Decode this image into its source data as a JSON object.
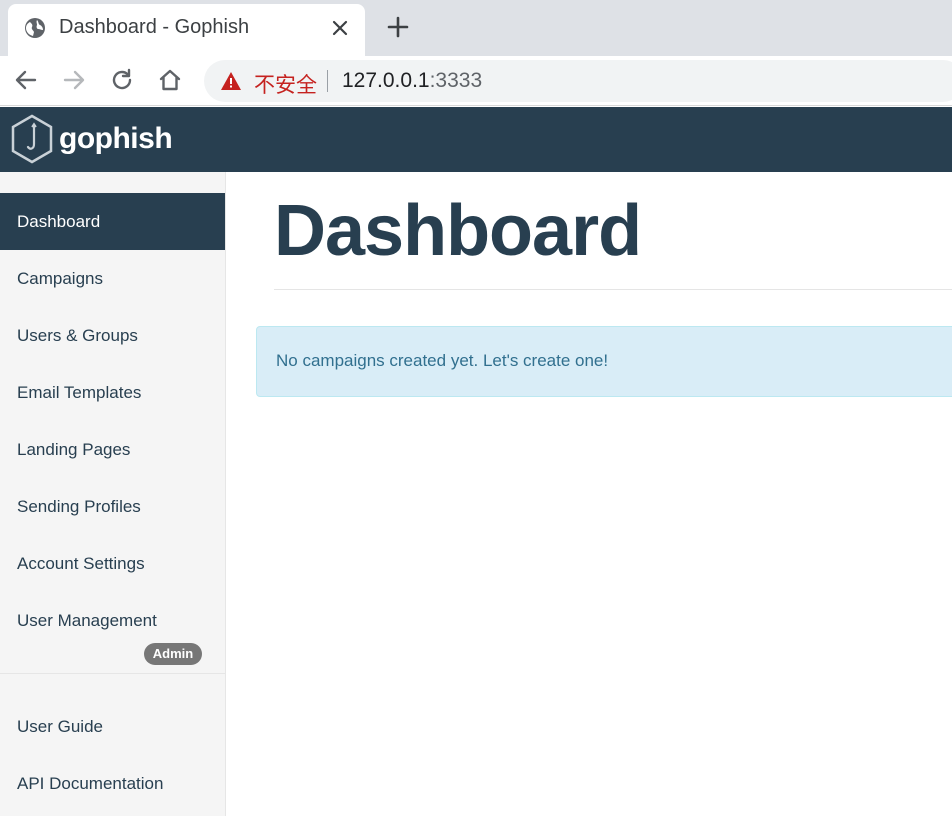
{
  "browser": {
    "tab_title": "Dashboard - Gophish",
    "security_label": "不安全",
    "url_host": "127.0.0.1",
    "url_port": ":3333",
    "icons": [
      "globe-icon",
      "close-icon",
      "plus-icon",
      "back-icon",
      "forward-icon",
      "reload-icon",
      "home-icon",
      "warning-icon"
    ]
  },
  "app": {
    "brand": "gophish",
    "brand_color": "#283f50"
  },
  "sidebar": {
    "items": [
      {
        "label": "Dashboard",
        "active": true
      },
      {
        "label": "Campaigns"
      },
      {
        "label": "Users & Groups"
      },
      {
        "label": "Email Templates"
      },
      {
        "label": "Landing Pages"
      },
      {
        "label": "Sending Profiles"
      },
      {
        "label": "Account Settings"
      },
      {
        "label": "User Management"
      }
    ],
    "admin_badge": "Admin",
    "secondary_items": [
      {
        "label": "User Guide"
      },
      {
        "label": "API Documentation"
      }
    ]
  },
  "main": {
    "title": "Dashboard",
    "alert": "No campaigns created yet. Let's create one!",
    "alert_color": "#d9edf7"
  }
}
